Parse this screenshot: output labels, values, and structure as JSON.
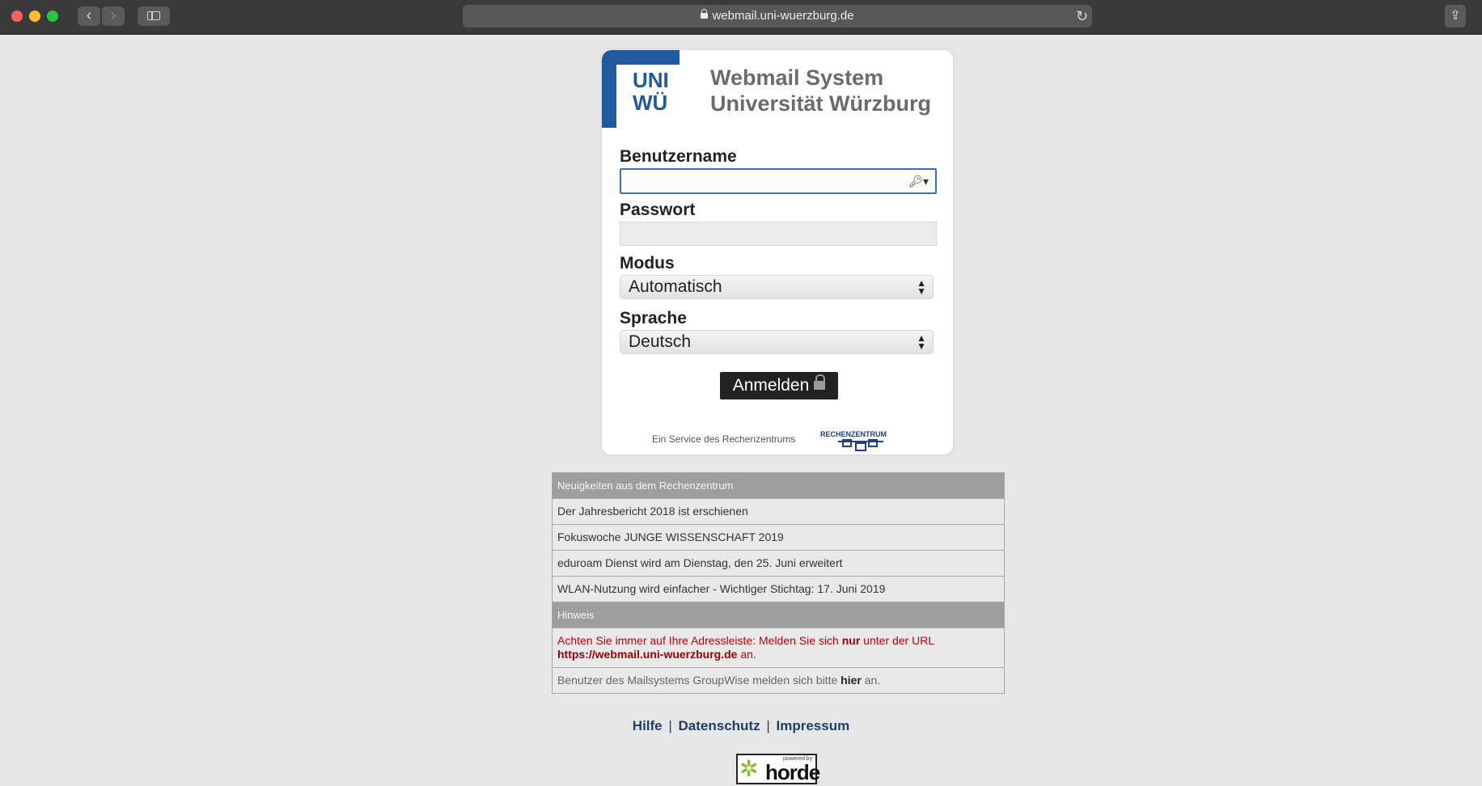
{
  "browser": {
    "url": "webmail.uni-wuerzburg.de",
    "back_icon": "‹",
    "forward_icon": "›",
    "reload_icon": "↻",
    "share_icon": "⇪"
  },
  "login": {
    "logo_line1": "UNI",
    "logo_line2": "WÜ",
    "title_line1": "Webmail System",
    "title_line2": "Universität Würzburg",
    "username_label": "Benutzername",
    "username_value": "",
    "password_label": "Passwort",
    "password_value": "",
    "mode_label": "Modus",
    "mode_selected": "Automatisch",
    "language_label": "Sprache",
    "language_selected": "Deutsch",
    "submit_label": "Anmelden",
    "service_text": "Ein Service des Rechenzentrums",
    "rz_logo_text": "RECHENZENTRUM"
  },
  "news": {
    "header": "Neuigkeiten aus dem Rechenzentrum",
    "items": [
      "Der Jahresbericht 2018 ist erschienen",
      "Fokuswoche JUNGE WISSENSCHAFT 2019",
      "eduroam Dienst wird am Dienstag, den 25. Juni erweitert",
      "WLAN-Nutzung wird einfacher - Wichtiger Stichtag: 17. Juni 2019"
    ],
    "notice_header": "Hinweis",
    "notice_part1": "Achten Sie immer auf Ihre Adressleiste: Melden Sie sich ",
    "notice_bold": "nur",
    "notice_part2": " unter der URL ",
    "notice_url": "https://webmail.uni-wuerzburg.de",
    "notice_part3": " an.",
    "groupwise_part1": "Benutzer des Mailsystems GroupWise melden sich bitte ",
    "groupwise_link": "hier",
    "groupwise_part2": " an."
  },
  "footer": {
    "help": "Hilfe",
    "privacy": "Datenschutz",
    "imprint": "Impressum",
    "separator": "|",
    "horde_small": "powered by",
    "horde_text": "horde"
  },
  "colors": {
    "uni_blue": "#1f5a9e",
    "notice_red": "#c0000a",
    "footer_link": "#233e66",
    "horde_green": "#84b82d"
  }
}
